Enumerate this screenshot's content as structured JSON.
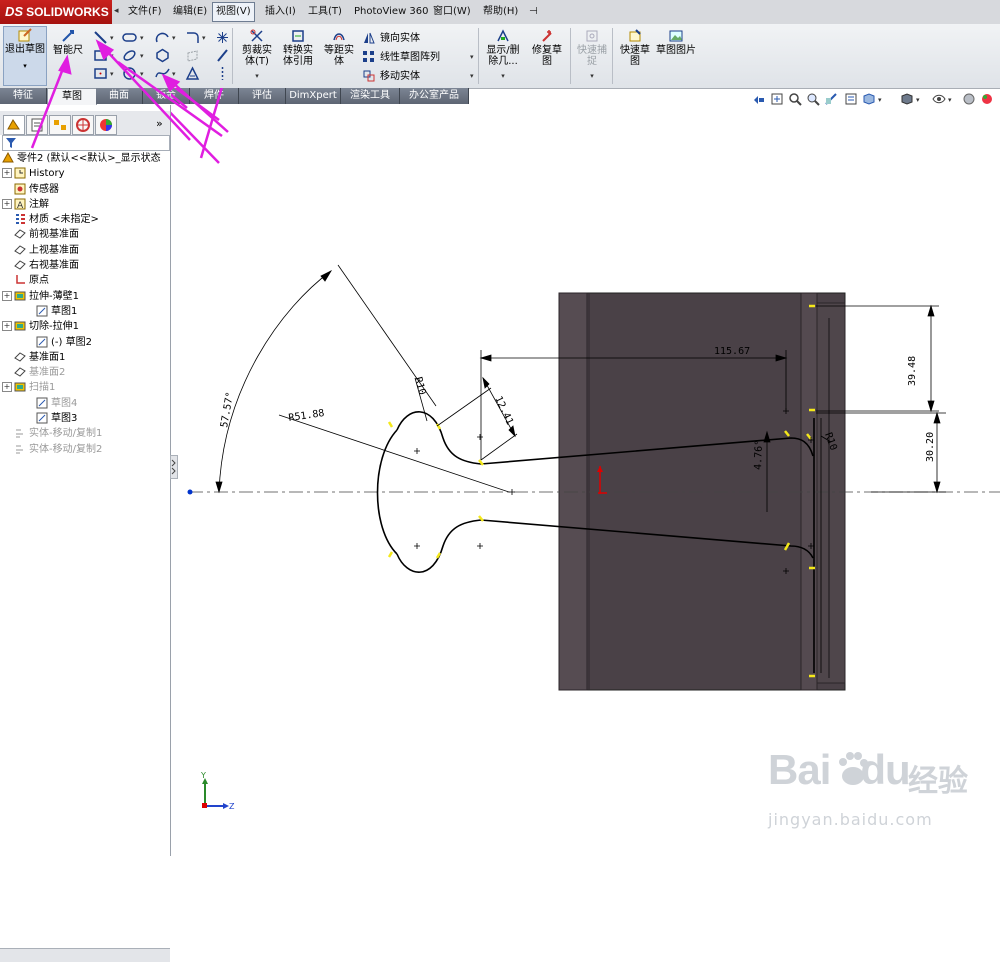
{
  "app": {
    "logo_text": "SOLIDWORKS",
    "logo_ds": "DS",
    "menus": [
      "文件(F)",
      "编辑(E)",
      "视图(V)",
      "插入(I)",
      "工具(T)",
      "PhotoView 360",
      "窗口(W)",
      "帮助(H)"
    ],
    "active_menu": "视图(V)"
  },
  "toolbar": {
    "exit_sketch": "退出草图",
    "smart_dimension": "智能尺",
    "trim": "剪裁实体(T)",
    "convert": "转换实体引用",
    "offset": "等距实体",
    "mirror": "镜向实体",
    "linear_pattern": "线性草图阵列",
    "move": "移动实体",
    "display_delete": "显示/删除几...",
    "repair": "修复草图",
    "quick_snap": "快速捕捉",
    "rapid_sketch": "快速草图",
    "sketch_picture": "草图图片"
  },
  "tabs": [
    "特征",
    "草图",
    "曲面",
    "钣金",
    "焊件",
    "评估",
    "DimXpert",
    "渲染工具",
    "办公室产品"
  ],
  "active_tab": "草图",
  "feature_tree": {
    "part": "零件2 (默认<<默认>_显示状态",
    "items": [
      {
        "label": "History",
        "indent": 0,
        "expand": true,
        "grey": false
      },
      {
        "label": "传感器",
        "indent": 0,
        "expand": false,
        "grey": false
      },
      {
        "label": "注解",
        "indent": 0,
        "expand": true,
        "grey": false
      },
      {
        "label": "材质 <未指定>",
        "indent": 0,
        "expand": false,
        "grey": false
      },
      {
        "label": "前视基准面",
        "indent": 0,
        "expand": false,
        "grey": false
      },
      {
        "label": "上视基准面",
        "indent": 0,
        "expand": false,
        "grey": false
      },
      {
        "label": "右视基准面",
        "indent": 0,
        "expand": false,
        "grey": false
      },
      {
        "label": "原点",
        "indent": 0,
        "expand": false,
        "grey": false
      },
      {
        "label": "拉伸-薄壁1",
        "indent": 0,
        "expand": true,
        "grey": false
      },
      {
        "label": "草图1",
        "indent": 1,
        "expand": false,
        "grey": false
      },
      {
        "label": "切除-拉伸1",
        "indent": 0,
        "expand": true,
        "grey": false
      },
      {
        "label": "(-) 草图2",
        "indent": 1,
        "expand": false,
        "grey": false
      },
      {
        "label": "基准面1",
        "indent": 0,
        "expand": false,
        "grey": false
      },
      {
        "label": "基准面2",
        "indent": 0,
        "expand": false,
        "grey": true
      },
      {
        "label": "扫描1",
        "indent": 0,
        "expand": true,
        "grey": true
      },
      {
        "label": "草图4",
        "indent": 1,
        "expand": false,
        "grey": true
      },
      {
        "label": "草图3",
        "indent": 1,
        "expand": false,
        "grey": false
      },
      {
        "label": "实体-移动/复制1",
        "indent": 0,
        "expand": false,
        "grey": true
      },
      {
        "label": "实体-移动/复制2",
        "indent": 0,
        "expand": false,
        "grey": true
      }
    ]
  },
  "sketch": {
    "dims": {
      "d1": "115.67",
      "d2": "39.48",
      "d3": "30.20",
      "d4": "12.41",
      "d5": "R10",
      "d6": "R10",
      "d7": "R51.88",
      "d8": "57.57°",
      "d9": "4.76°"
    }
  },
  "triad": {
    "y": "Y",
    "z": "Z"
  },
  "watermark": {
    "brand": "Bai",
    "brand2": "du",
    "cn": "经验",
    "url": "jingyan.baidu.com"
  },
  "colors": {
    "accent": "#c9211e",
    "part_face": "#4a4147",
    "arrow": "#e01ee0",
    "endpoint": "#f4e81a"
  }
}
